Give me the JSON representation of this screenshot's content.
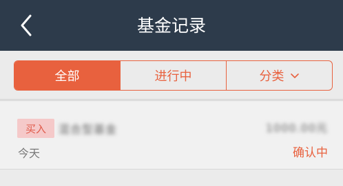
{
  "header": {
    "title": "基金记录",
    "back_icon": "chevron-left-icon"
  },
  "tabs": [
    {
      "label": "全部",
      "active": true
    },
    {
      "label": "进行中",
      "active": false
    },
    {
      "label": "分类",
      "active": false,
      "icon": "chevron-down-icon"
    }
  ],
  "colors": {
    "header_bg": "#2d3b4b",
    "accent": "#e8613e",
    "badge_bg": "#f5c9c9"
  },
  "records": [
    {
      "type": "买入",
      "fund_name": "混合型基金",
      "date": "今天",
      "amount": "1000.00元",
      "status": "确认中"
    }
  ]
}
